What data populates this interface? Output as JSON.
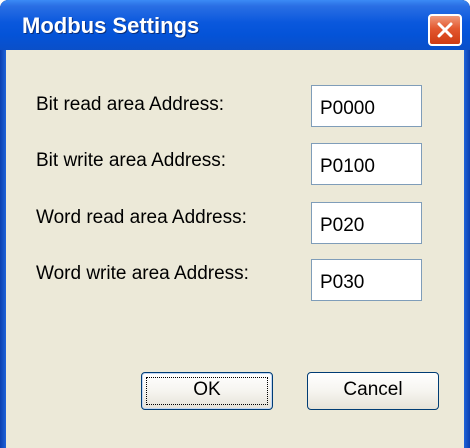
{
  "window": {
    "title": "Modbus Settings",
    "close_icon": "close-icon"
  },
  "fields": [
    {
      "label": "Bit read area Address:",
      "value": "P0000"
    },
    {
      "label": "Bit write area Address:",
      "value": "P0100"
    },
    {
      "label": "Word read area Address:",
      "value": "P020"
    },
    {
      "label": "Word write area Address:",
      "value": "P030"
    }
  ],
  "buttons": {
    "ok_label": "OK",
    "cancel_label": "Cancel"
  },
  "colors": {
    "titlebar": "#0453d8",
    "close_button": "#e3582f",
    "dialog_background": "#ece9d8"
  }
}
